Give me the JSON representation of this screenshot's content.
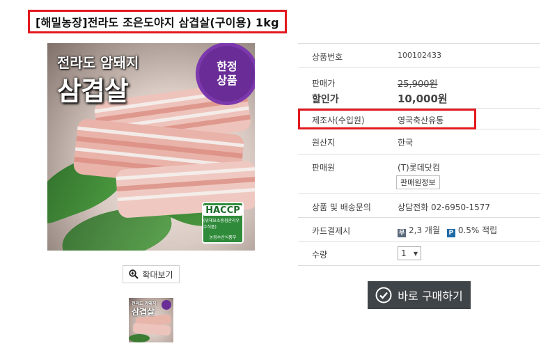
{
  "title": "[해밀농장]전라도 조은도야지 삼겹살(구이용) 1kg",
  "image": {
    "line1": "전라도 암돼지",
    "line2": "삼겹살",
    "badge_line1": "한정",
    "badge_line2": "상품",
    "haccp_main": "HACCP",
    "haccp_sub": "(위해요소중점관리우수식품)",
    "haccp_foot": "농림수산식품부"
  },
  "zoom_label": "확대보기",
  "info": {
    "product_no_label": "상품번호",
    "product_no_value": "100102433",
    "price_label": "판매가",
    "price_value": "25,900원",
    "sale_label": "할인가",
    "sale_value": "10,000원",
    "maker_label": "제조사(수입원)",
    "maker_value": "영국축산유통",
    "origin_label": "원산지",
    "origin_value": "한국",
    "seller_label": "판매원",
    "seller_value": "(T)롯데닷컴",
    "seller_info_button": "판매원정보",
    "inquiry_label": "상품 및 배송문의",
    "inquiry_value": "상담전화 02-6950-1577",
    "card_label": "카드결제시",
    "card_installment": "2,3 개월",
    "card_points": "0.5% 적립",
    "qty_label": "수량",
    "qty_value": "1"
  },
  "buy_label": "바로 구매하기",
  "colors": {
    "highlight": "#e1191e",
    "sale": "#c8640a",
    "buy_button": "#3f4448",
    "badge": "#6a2d97"
  }
}
